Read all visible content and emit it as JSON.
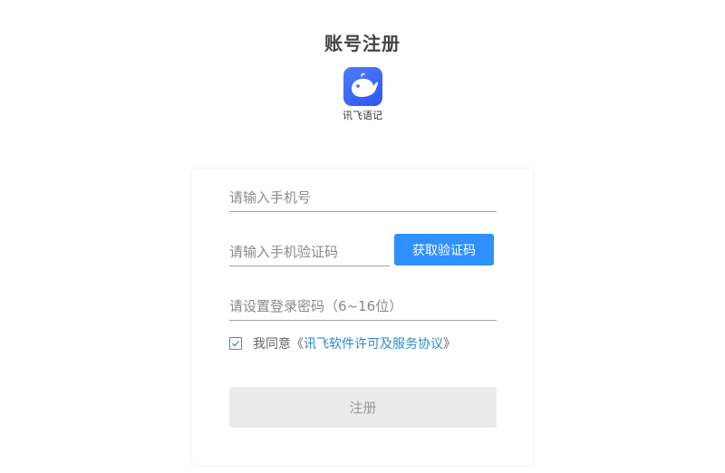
{
  "header": {
    "title": "账号注册",
    "app_name": "讯飞语记",
    "logo_icon": "whale-icon",
    "logo_color": "#3d6bfb"
  },
  "form": {
    "phone_placeholder": "请输入手机号",
    "code_placeholder": "请输入手机验证码",
    "get_code_label": "获取验证码",
    "password_placeholder": "请设置登录密码（6~16位）",
    "agreement": {
      "checked": true,
      "prefix": "我同意《",
      "link_text": "讯飞软件许可及服务协议",
      "suffix": "》"
    },
    "register_label": "注册"
  },
  "colors": {
    "primary": "#2f90ff",
    "link": "#2a8ad4",
    "disabled_button_bg": "#ebebeb",
    "disabled_button_text": "#999999"
  }
}
